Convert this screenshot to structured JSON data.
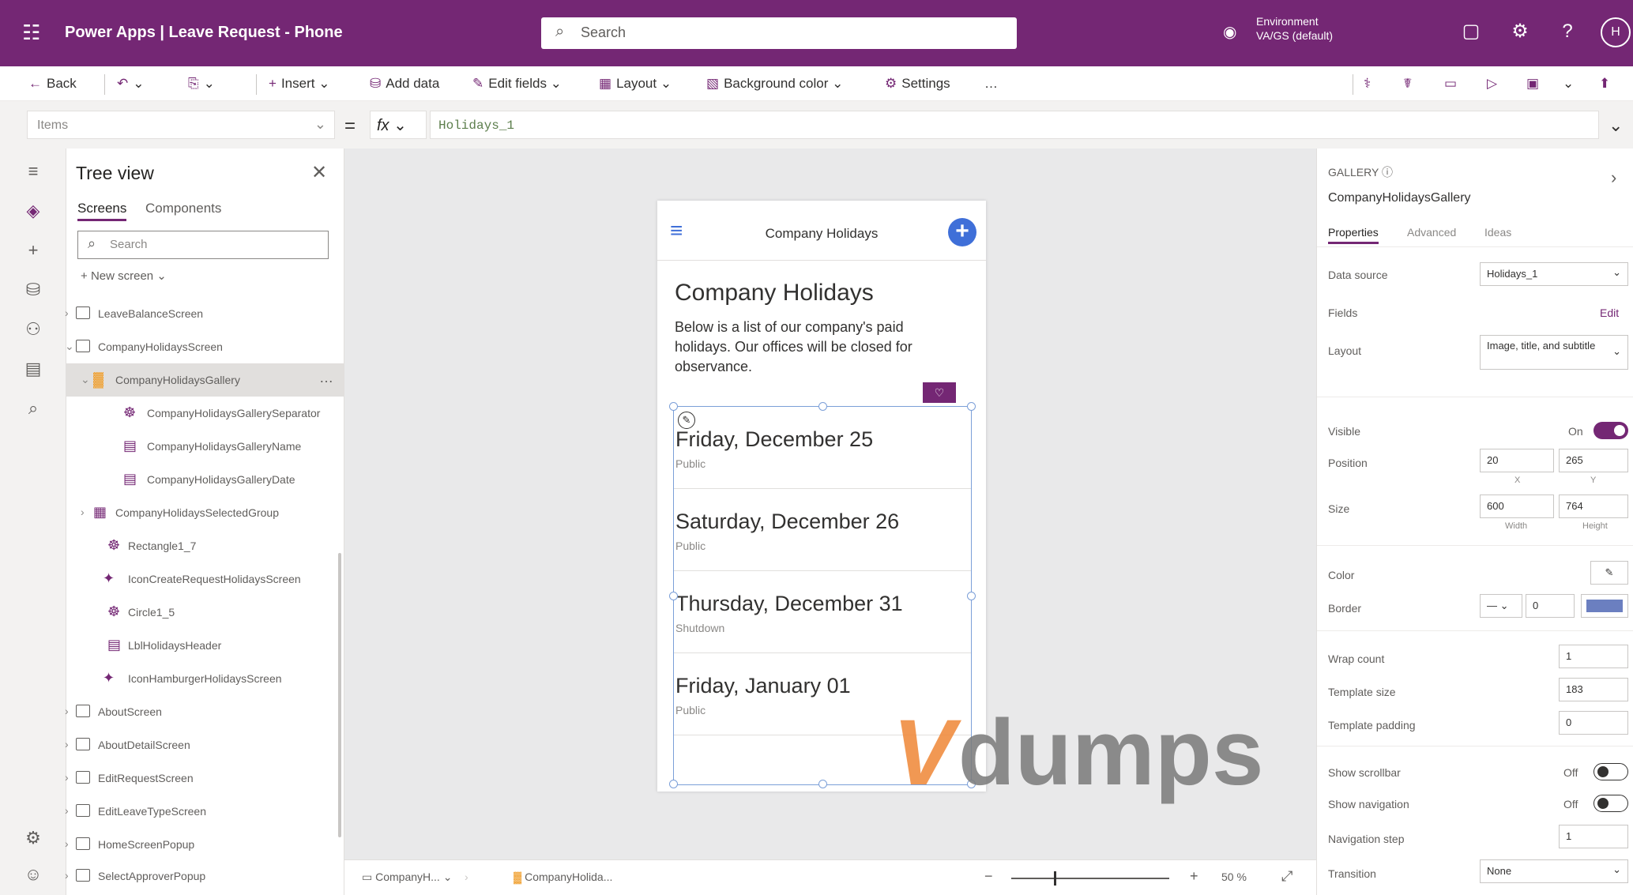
{
  "topbar": {
    "app_title": "Power Apps  |  Leave Request - Phone",
    "search_placeholder": "Search",
    "environment_label": "Environment",
    "environment_value": "VA/GS (default)",
    "avatar_initial": "H"
  },
  "commands": {
    "back": "Back",
    "insert": "Insert",
    "add_data": "Add data",
    "edit_fields": "Edit fields",
    "layout": "Layout",
    "background_color": "Background color",
    "settings": "Settings"
  },
  "formula_bar": {
    "property": "Items",
    "formula": "Holidays_1"
  },
  "tree": {
    "title": "Tree view",
    "tabs": [
      "Screens",
      "Components"
    ],
    "search_placeholder": "Search",
    "new_screen": "New screen",
    "items": [
      {
        "label": "LeaveBalanceScreen"
      },
      {
        "label": "CompanyHolidaysScreen"
      },
      {
        "label": "CompanyHolidaysGallery"
      },
      {
        "label": "CompanyHolidaysGallerySeparator"
      },
      {
        "label": "CompanyHolidaysGalleryName"
      },
      {
        "label": "CompanyHolidaysGalleryDate"
      },
      {
        "label": "CompanyHolidaysSelectedGroup"
      },
      {
        "label": "Rectangle1_7"
      },
      {
        "label": "IconCreateRequestHolidaysScreen"
      },
      {
        "label": "Circle1_5"
      },
      {
        "label": "LblHolidaysHeader"
      },
      {
        "label": "IconHamburgerHolidaysScreen"
      },
      {
        "label": "AboutScreen"
      },
      {
        "label": "AboutDetailScreen"
      },
      {
        "label": "EditRequestScreen"
      },
      {
        "label": "EditLeaveTypeScreen"
      },
      {
        "label": "HomeScreenPopup"
      },
      {
        "label": "SelectApproverPopup"
      }
    ]
  },
  "phone": {
    "header_title": "Company Holidays",
    "page_title": "Company Holidays",
    "description": "Below is a list of our company's paid holidays. Our offices will be closed for observance.",
    "gallery": [
      {
        "date": "Friday, December 25",
        "type": "Public"
      },
      {
        "date": "Saturday, December 26",
        "type": "Public"
      },
      {
        "date": "Thursday, December 31",
        "type": "Shutdown"
      },
      {
        "date": "Friday, January 01",
        "type": "Public"
      }
    ]
  },
  "bottom_bar": {
    "screen": "CompanyH...",
    "control": "CompanyHolida...",
    "zoom": "50 %"
  },
  "properties": {
    "category": "GALLERY",
    "control_name": "CompanyHolidaysGallery",
    "tabs": [
      "Properties",
      "Advanced",
      "Ideas"
    ],
    "data_source_label": "Data source",
    "data_source": "Holidays_1",
    "fields_label": "Fields",
    "fields_edit": "Edit",
    "layout_label": "Layout",
    "layout": "Image, title, and subtitle",
    "visible_label": "Visible",
    "visible_state": "On",
    "position_label": "Position",
    "position_x": "20",
    "position_y": "265",
    "x_label": "X",
    "y_label": "Y",
    "size_label": "Size",
    "size_w": "600",
    "size_h": "764",
    "width_label": "Width",
    "height_label": "Height",
    "color_label": "Color",
    "border_label": "Border",
    "border_width": "0",
    "border_color": "#6b7fc0",
    "wrap_count_label": "Wrap count",
    "wrap_count": "1",
    "template_size_label": "Template size",
    "template_size": "183",
    "template_padding_label": "Template padding",
    "template_padding": "0",
    "show_scrollbar_label": "Show scrollbar",
    "show_scrollbar": "Off",
    "show_navigation_label": "Show navigation",
    "show_navigation": "Off",
    "navigation_step_label": "Navigation step",
    "navigation_step": "1",
    "transition_label": "Transition",
    "transition": "None"
  },
  "watermark": {
    "v": "V",
    "text": "dumps"
  },
  "colors": {
    "brand": "#742774",
    "accent_blue": "#3f6fd8"
  }
}
